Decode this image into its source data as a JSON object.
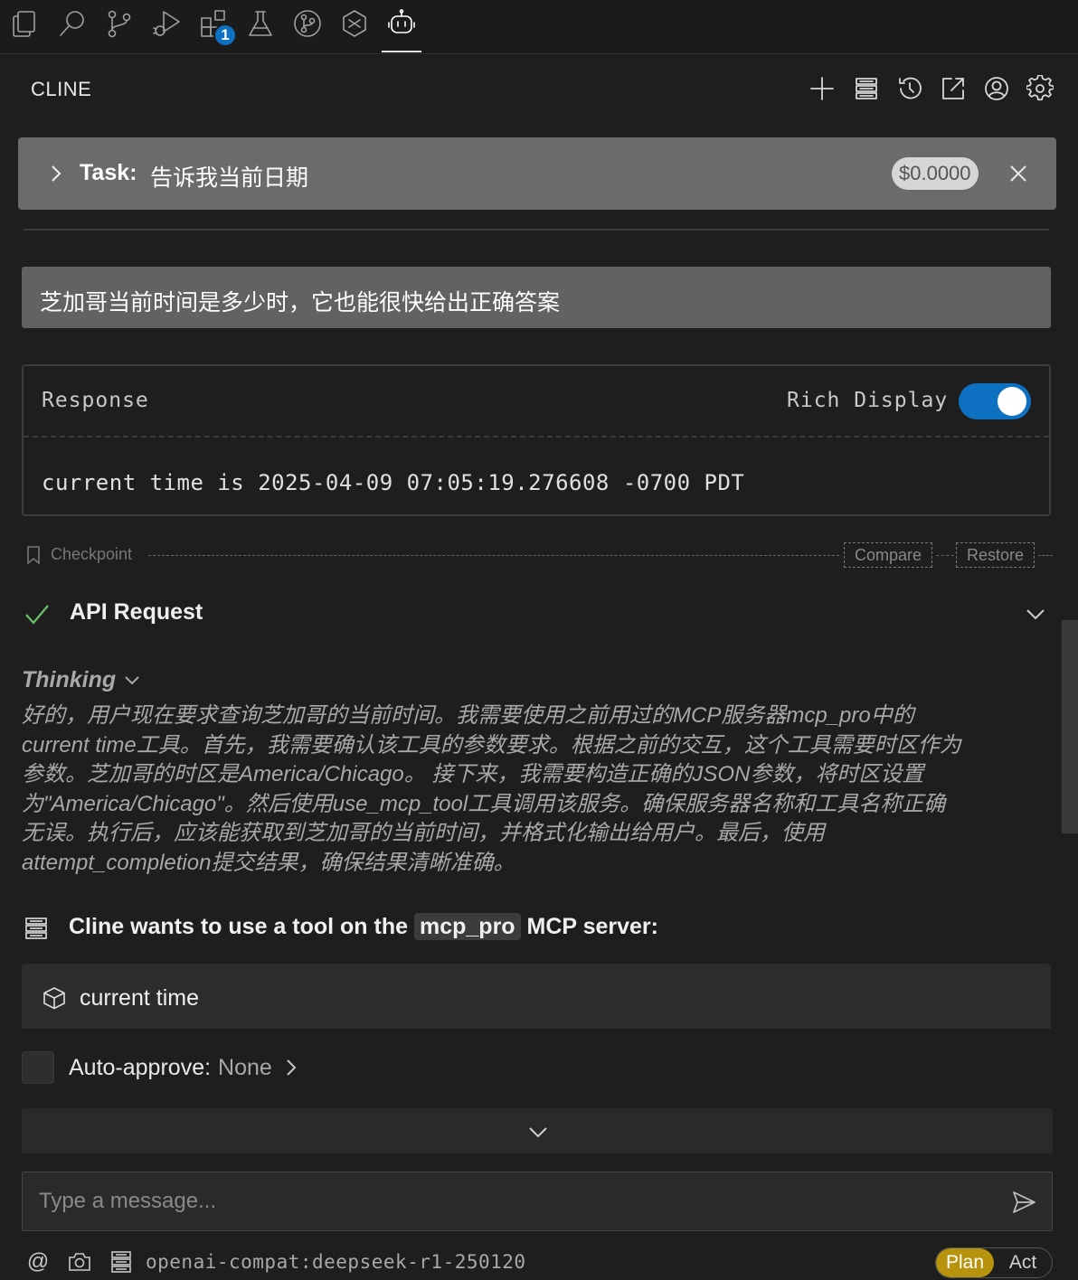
{
  "activity_bar": {
    "icons": [
      "files-icon",
      "search-icon",
      "source-control-icon",
      "run-debug-icon",
      "extensions-icon",
      "testing-icon",
      "git-graph-icon",
      "ai-extension-icon",
      "cline-robot-icon"
    ],
    "extensions_badge": "1"
  },
  "header": {
    "title": "CLINE",
    "actions": [
      "new-task",
      "mcp-servers",
      "history",
      "open-in-editor",
      "account",
      "settings"
    ]
  },
  "task": {
    "label": "Task:",
    "text": "告诉我当前日期",
    "cost": "$0.0000"
  },
  "user_message": "芝加哥当前时间是多少时，它也能很快给出正确答案",
  "response": {
    "label": "Response",
    "rich_display_label": "Rich Display",
    "rich_display_on": true,
    "text": "current time is 2025-04-09 07:05:19.276608 -0700 PDT"
  },
  "checkpoint": {
    "label": "Checkpoint",
    "compare_label": "Compare",
    "restore_label": "Restore"
  },
  "api_request": {
    "label": "API Request",
    "status": "success"
  },
  "thinking": {
    "label": "Thinking",
    "lines": [
      "好的，用户现在要求查询芝加哥的当前时间。我需要使用之前用过的MCP服务器mcp_pro中的",
      "current time工具。首先，我需要确认该工具的参数要求。根据之前的交互，这个工具需要时区作为",
      "参数。芝加哥的时区是America/Chicago。 接下来，我需要构造正确的JSON参数，将时区设置",
      "为\"America/Chicago\"。然后使用use_mcp_tool工具调用该服务。确保服务器名称和工具名称正确",
      "无误。执行后，应该能获取到芝加哥的当前时间，并格式化输出给用户。最后，使用",
      "attempt_completion提交结果，确保结果清晰准确。"
    ]
  },
  "tool_use": {
    "prefix": "Cline wants to use a tool on the",
    "server": "mcp_pro",
    "suffix": "MCP server:",
    "tool_name": "current time"
  },
  "auto_approve": {
    "label": "Auto-approve:",
    "value": "None"
  },
  "input": {
    "placeholder": "Type a message..."
  },
  "footer": {
    "at_symbol": "@",
    "model": "openai-compat:deepseek-r1-250120",
    "plan_label": "Plan",
    "act_label": "Act",
    "active_mode": "Plan"
  },
  "colors": {
    "accent_blue": "#0e70c0",
    "success_green": "#6cc36c",
    "plan_gold": "#b8930e"
  }
}
